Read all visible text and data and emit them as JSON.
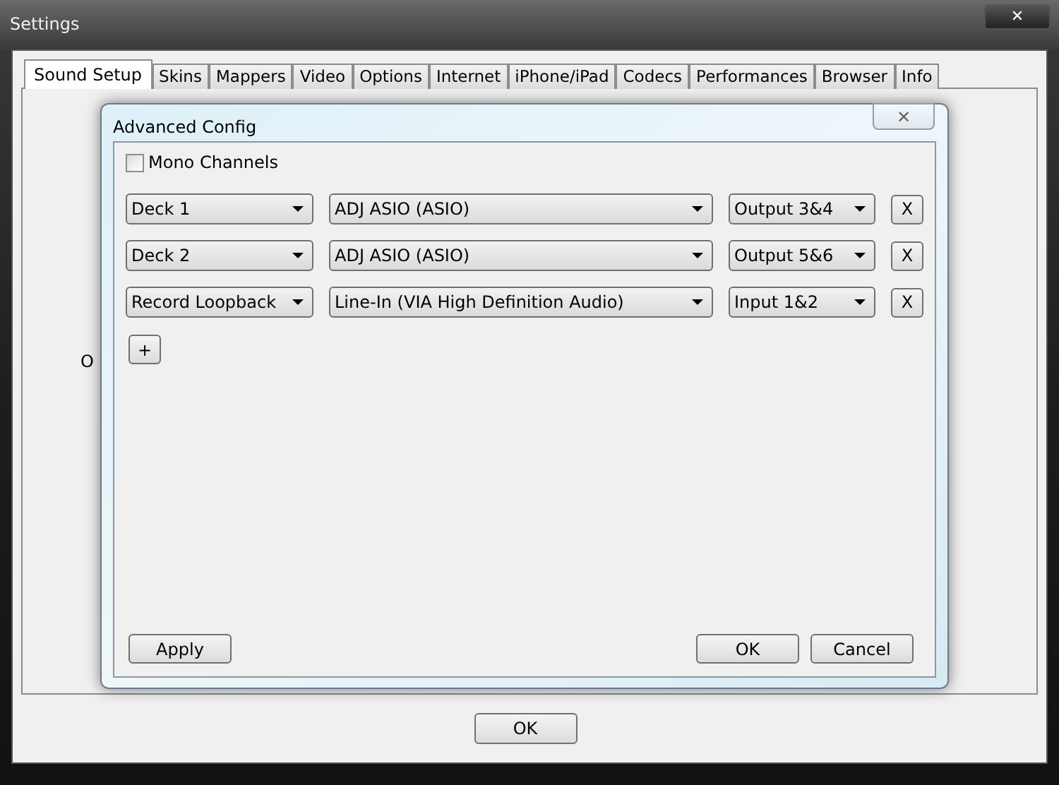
{
  "window": {
    "title": "Settings",
    "close": "✕"
  },
  "tabs": [
    {
      "label": "Sound Setup",
      "selected": true
    },
    {
      "label": "Skins",
      "selected": false
    },
    {
      "label": "Mappers",
      "selected": false
    },
    {
      "label": "Video",
      "selected": false
    },
    {
      "label": "Options",
      "selected": false
    },
    {
      "label": "Internet",
      "selected": false
    },
    {
      "label": "iPhone/iPad",
      "selected": false
    },
    {
      "label": "Codecs",
      "selected": false
    },
    {
      "label": "Performances",
      "selected": false
    },
    {
      "label": "Browser",
      "selected": false
    },
    {
      "label": "Info",
      "selected": false
    }
  ],
  "panel_text": "O",
  "dialog": {
    "title": "Advanced Config",
    "close": "✕",
    "mono_channels": {
      "label": "Mono Channels",
      "checked": false
    },
    "rows": [
      {
        "channel": "Deck 1",
        "device": "ADJ ASIO (ASIO)",
        "port": "Output 3&4",
        "remove": "X"
      },
      {
        "channel": "Deck 2",
        "device": "ADJ ASIO (ASIO)",
        "port": "Output 5&6",
        "remove": "X"
      },
      {
        "channel": "Record Loopback",
        "device": "Line-In (VIA High Definition Audio)",
        "port": "Input 1&2",
        "remove": "X"
      }
    ],
    "add": "+",
    "buttons": [
      "Apply",
      "OK",
      "Cancel"
    ]
  },
  "ok_button": "OK"
}
